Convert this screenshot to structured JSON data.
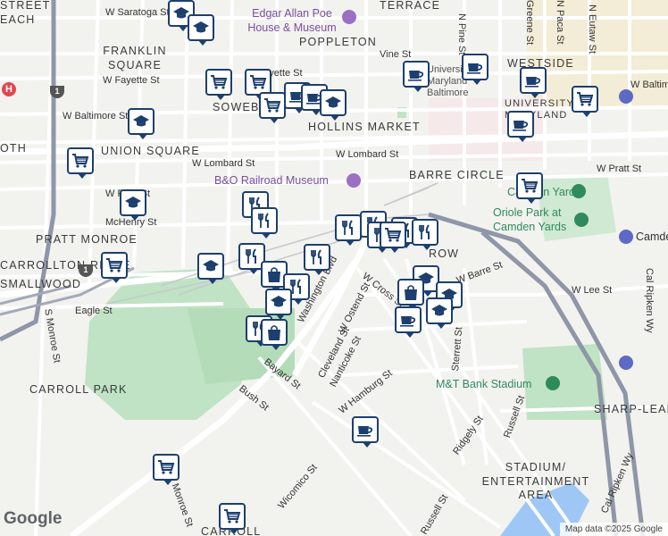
{
  "area_labels": [
    "FRANKLIN SQUARE",
    "POPPLETON",
    "WESTSIDE",
    "SOWEBO",
    "HOLLINS MARKET",
    "UNIVERSITY OF MARYLAND",
    "UNION SQUARE",
    "BARRE CIRCLE",
    "PRATT MONROE",
    "CARROLLTON RIDGE",
    "SMALLWOOD",
    "CARROLL PARK",
    "STADIUM/ ENTERTAINMENT AREA",
    "SHARP-LEADENHALL",
    "CARROLL",
    "TERRACE",
    "OTH",
    "ROW",
    "STREET",
    "EACH"
  ],
  "street_labels": [
    "W Saratoga St",
    "W Fayette St",
    "W Fayette St",
    "W Baltimore St",
    "W Lombard St",
    "W Lombard St",
    "W Pratt St",
    "W Pratt St",
    "Vine St",
    "W Baltimore St",
    "Eagle St",
    "W Lee St",
    "S Monroe St",
    "Bayard St",
    "Bush St",
    "W Cross St",
    "W Ostend St",
    "Cleveland St",
    "Nanticoke St",
    "W Hamburg St",
    "Sterrett St",
    "Russell St",
    "Ridgely St",
    "Wicomico St",
    "Monroe St",
    "Cal Ripken Wy",
    "Cal Ripken Wy",
    "N Pine St",
    "N Eutaw St",
    "Washington Blvd",
    "W Barre St",
    "McHenry St",
    "Greene St",
    "N Paca St"
  ],
  "poi_labels": {
    "poe_house": "Edgar Allan Poe House & Museum",
    "bo_museum": "B&O Railroad Museum",
    "camden_yards": "Camden Yards",
    "oriole_park": "Oriole Park at Camden Yards",
    "camden": "Camden",
    "mt_stadium": "M&T Bank Stadium",
    "university": "University of Maryland Baltimore"
  },
  "route_shields": [
    "1",
    "1"
  ],
  "hospital_symbol": "H",
  "markers": [
    {
      "icon": "school-icon"
    },
    {
      "icon": "school-icon"
    },
    {
      "icon": "grocery-cart-icon"
    },
    {
      "icon": "grocery-cart-icon"
    },
    {
      "icon": "grocery-cart-icon"
    },
    {
      "icon": "cafe-cup-icon"
    },
    {
      "icon": "cafe-cup-icon"
    },
    {
      "icon": "school-icon"
    },
    {
      "icon": "cafe-cup-icon"
    },
    {
      "icon": "cafe-cup-icon"
    },
    {
      "icon": "school-icon"
    },
    {
      "icon": "grocery-cart-icon"
    },
    {
      "icon": "cafe-cup-icon"
    },
    {
      "icon": "cafe-cup-icon"
    },
    {
      "icon": "grocery-cart-icon"
    },
    {
      "icon": "grocery-cart-icon"
    },
    {
      "icon": "school-icon"
    },
    {
      "icon": "restaurant-icon"
    },
    {
      "icon": "restaurant-icon"
    },
    {
      "icon": "restaurant-icon"
    },
    {
      "icon": "restaurant-icon"
    },
    {
      "icon": "restaurant-icon"
    },
    {
      "icon": "restaurant-icon"
    },
    {
      "icon": "grocery-cart-icon"
    },
    {
      "icon": "restaurant-icon"
    },
    {
      "icon": "grocery-cart-icon"
    },
    {
      "icon": "school-icon"
    },
    {
      "icon": "restaurant-icon"
    },
    {
      "icon": "shopping-bag-icon"
    },
    {
      "icon": "restaurant-icon"
    },
    {
      "icon": "restaurant-icon"
    },
    {
      "icon": "school-icon"
    },
    {
      "icon": "restaurant-icon"
    },
    {
      "icon": "shopping-bag-icon"
    },
    {
      "icon": "school-icon"
    },
    {
      "icon": "shopping-bag-icon"
    },
    {
      "icon": "school-icon"
    },
    {
      "icon": "school-icon"
    },
    {
      "icon": "cafe-cup-icon"
    },
    {
      "icon": "cafe-cup-icon"
    },
    {
      "icon": "grocery-cart-icon"
    },
    {
      "icon": "grocery-cart-icon"
    }
  ],
  "google_logo": "Google",
  "attribution": "Map data ©2025 Google",
  "colors": {
    "marker_border": "#1c3f6e",
    "park": "#bfe3c4",
    "water": "#9fc7f5",
    "highway": "#8f96a8",
    "land": "#f2f2ef"
  }
}
